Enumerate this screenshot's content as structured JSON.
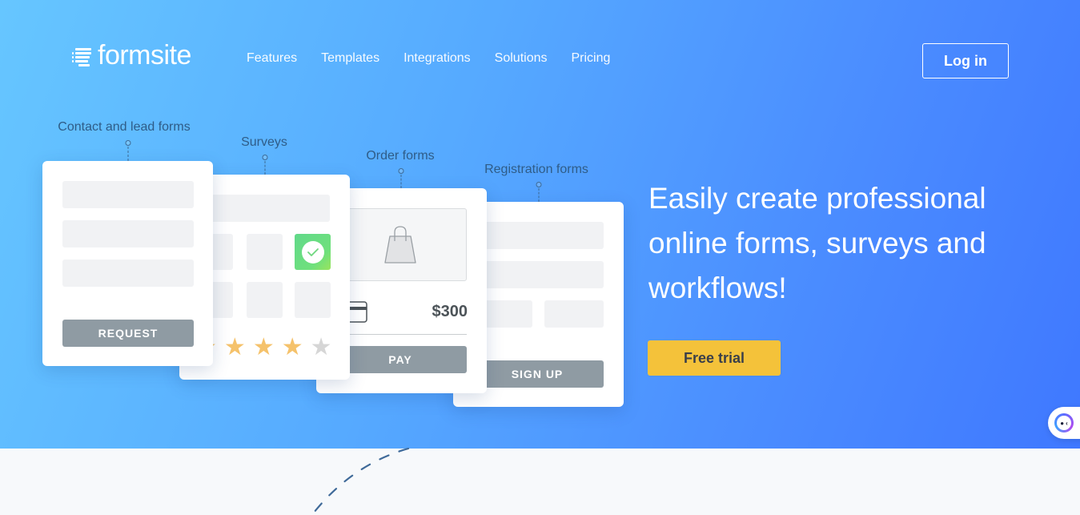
{
  "header": {
    "logo_text": "formsite",
    "nav": [
      {
        "label": "Features"
      },
      {
        "label": "Templates"
      },
      {
        "label": "Integrations"
      },
      {
        "label": "Solutions"
      },
      {
        "label": "Pricing"
      }
    ],
    "login_label": "Log in"
  },
  "illustration": {
    "contact": {
      "label": "Contact and lead forms",
      "button": "REQUEST"
    },
    "survey": {
      "label": "Surveys",
      "rating": 4,
      "rating_max": 5
    },
    "order": {
      "label": "Order forms",
      "price": "$300",
      "button": "PAY"
    },
    "registration": {
      "label": "Registration forms",
      "button": "SIGN UP"
    }
  },
  "hero": {
    "headline": "Easily create professional online forms, surveys and workflows!",
    "cta_label": "Free trial"
  },
  "colors": {
    "gradient_start": "#66c6ff",
    "gradient_end": "#3f78ff",
    "cta": "#f4c23a",
    "star_filled": "#f5c26b",
    "star_empty": "#d6d6d6",
    "check_green": "#6fe07c",
    "button_gray": "#8f9ba3"
  },
  "icons": {
    "logo": "list-lines-icon",
    "check": "check-circle-icon",
    "bag": "shopping-bag-icon",
    "card": "credit-card-icon",
    "chat": "chat-bot-icon"
  }
}
